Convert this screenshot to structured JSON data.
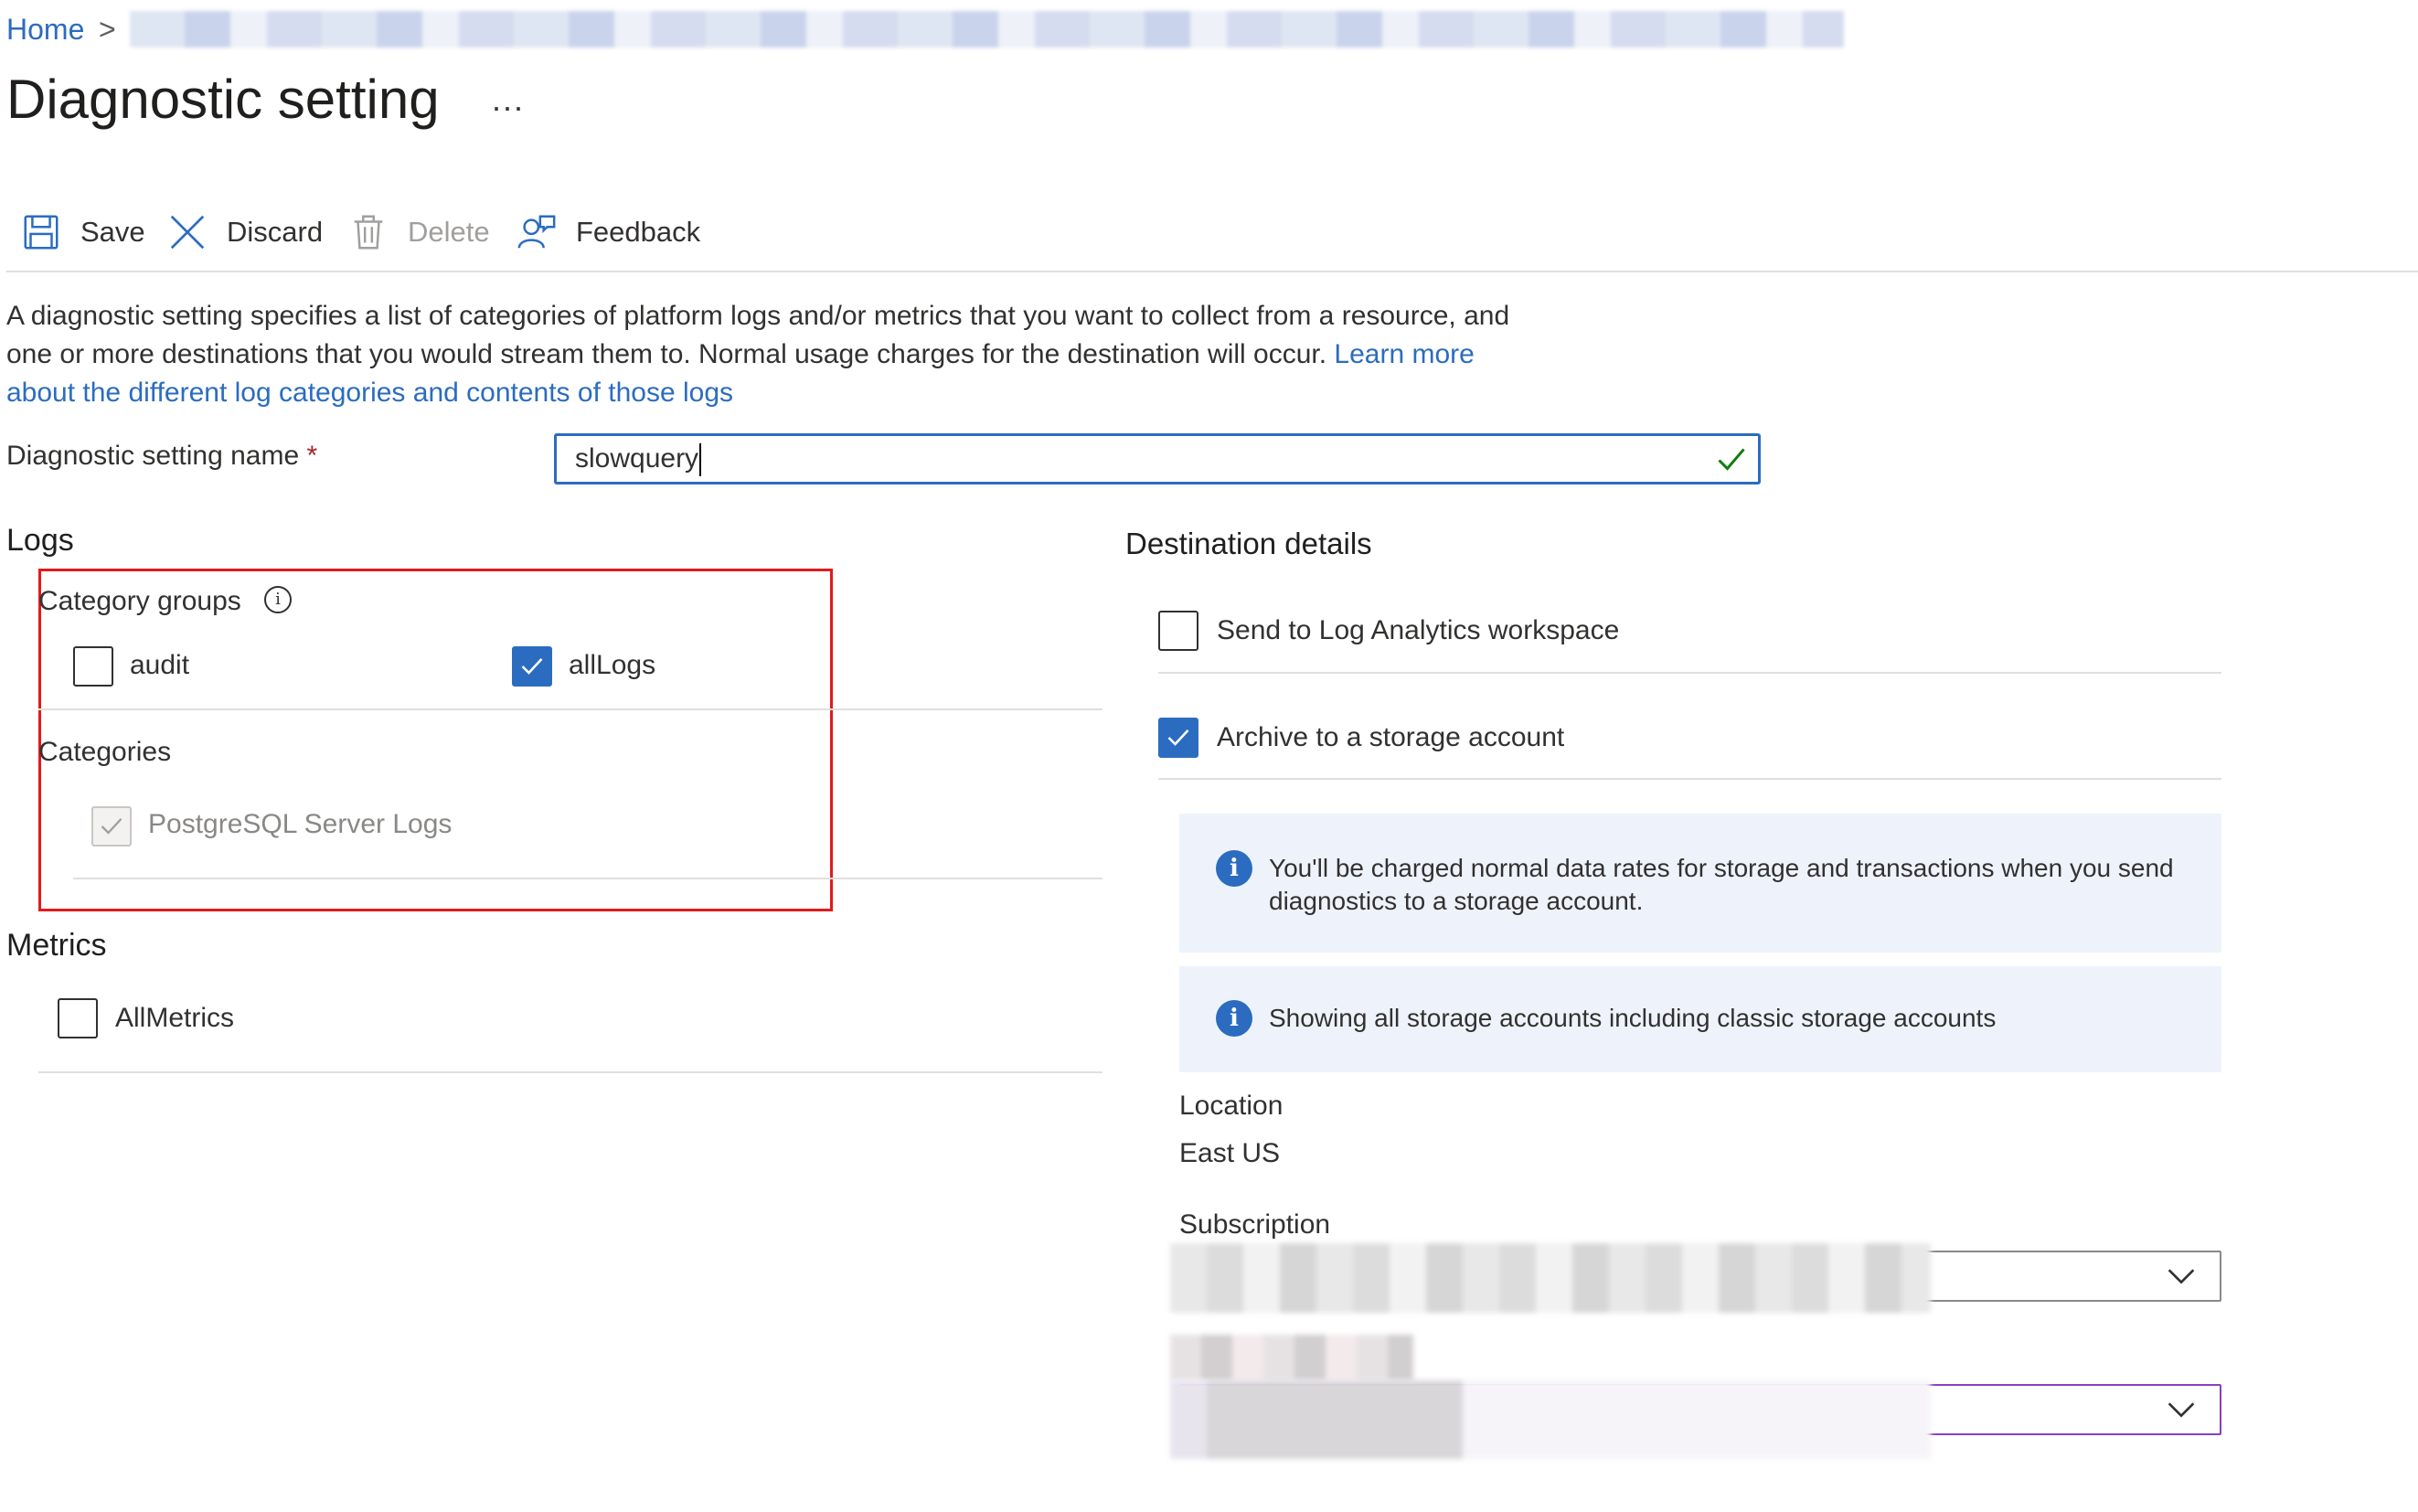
{
  "breadcrumb": {
    "home": "Home",
    "separator": ">"
  },
  "page": {
    "title": "Diagnostic setting",
    "more": "..."
  },
  "toolbar": {
    "save": "Save",
    "discard": "Discard",
    "delete": "Delete",
    "feedback": "Feedback"
  },
  "description": {
    "text": "A diagnostic setting specifies a list of categories of platform logs and/or metrics that you want to collect from a resource, and one or more destinations that you would stream them to. Normal usage charges for the destination will occur.",
    "link": "Learn more about the different log categories and contents of those logs"
  },
  "name_field": {
    "label": "Diagnostic setting name",
    "required_mark": "*",
    "value": "slowquery"
  },
  "logs": {
    "heading": "Logs",
    "category_groups_label": "Category groups",
    "category_groups": [
      {
        "label": "audit",
        "checked": false
      },
      {
        "label": "allLogs",
        "checked": true
      }
    ],
    "categories_label": "Categories",
    "categories": [
      {
        "label": "PostgreSQL Server Logs",
        "checked": true,
        "disabled": true
      }
    ]
  },
  "metrics": {
    "heading": "Metrics",
    "items": [
      {
        "label": "AllMetrics",
        "checked": false
      }
    ]
  },
  "destination": {
    "heading": "Destination details",
    "options": [
      {
        "label": "Send to Log Analytics workspace",
        "checked": false
      },
      {
        "label": "Archive to a storage account",
        "checked": true
      }
    ],
    "info_charges": "You'll be charged normal data rates for storage and transactions when you send diagnostics to a storage account.",
    "info_classic": "Showing all storage accounts including classic storage accounts",
    "location_label": "Location",
    "location_value": "East US",
    "subscription_label": "Subscription"
  },
  "colors": {
    "accent": "#2b6cc0",
    "highlight": "#e3191b",
    "required": "#a4262c",
    "valid": "#107c10"
  },
  "icons": [
    "save-icon",
    "discard-icon",
    "delete-icon",
    "feedback-icon",
    "info-circle-icon",
    "checkmark-icon",
    "chevron-down-icon"
  ]
}
